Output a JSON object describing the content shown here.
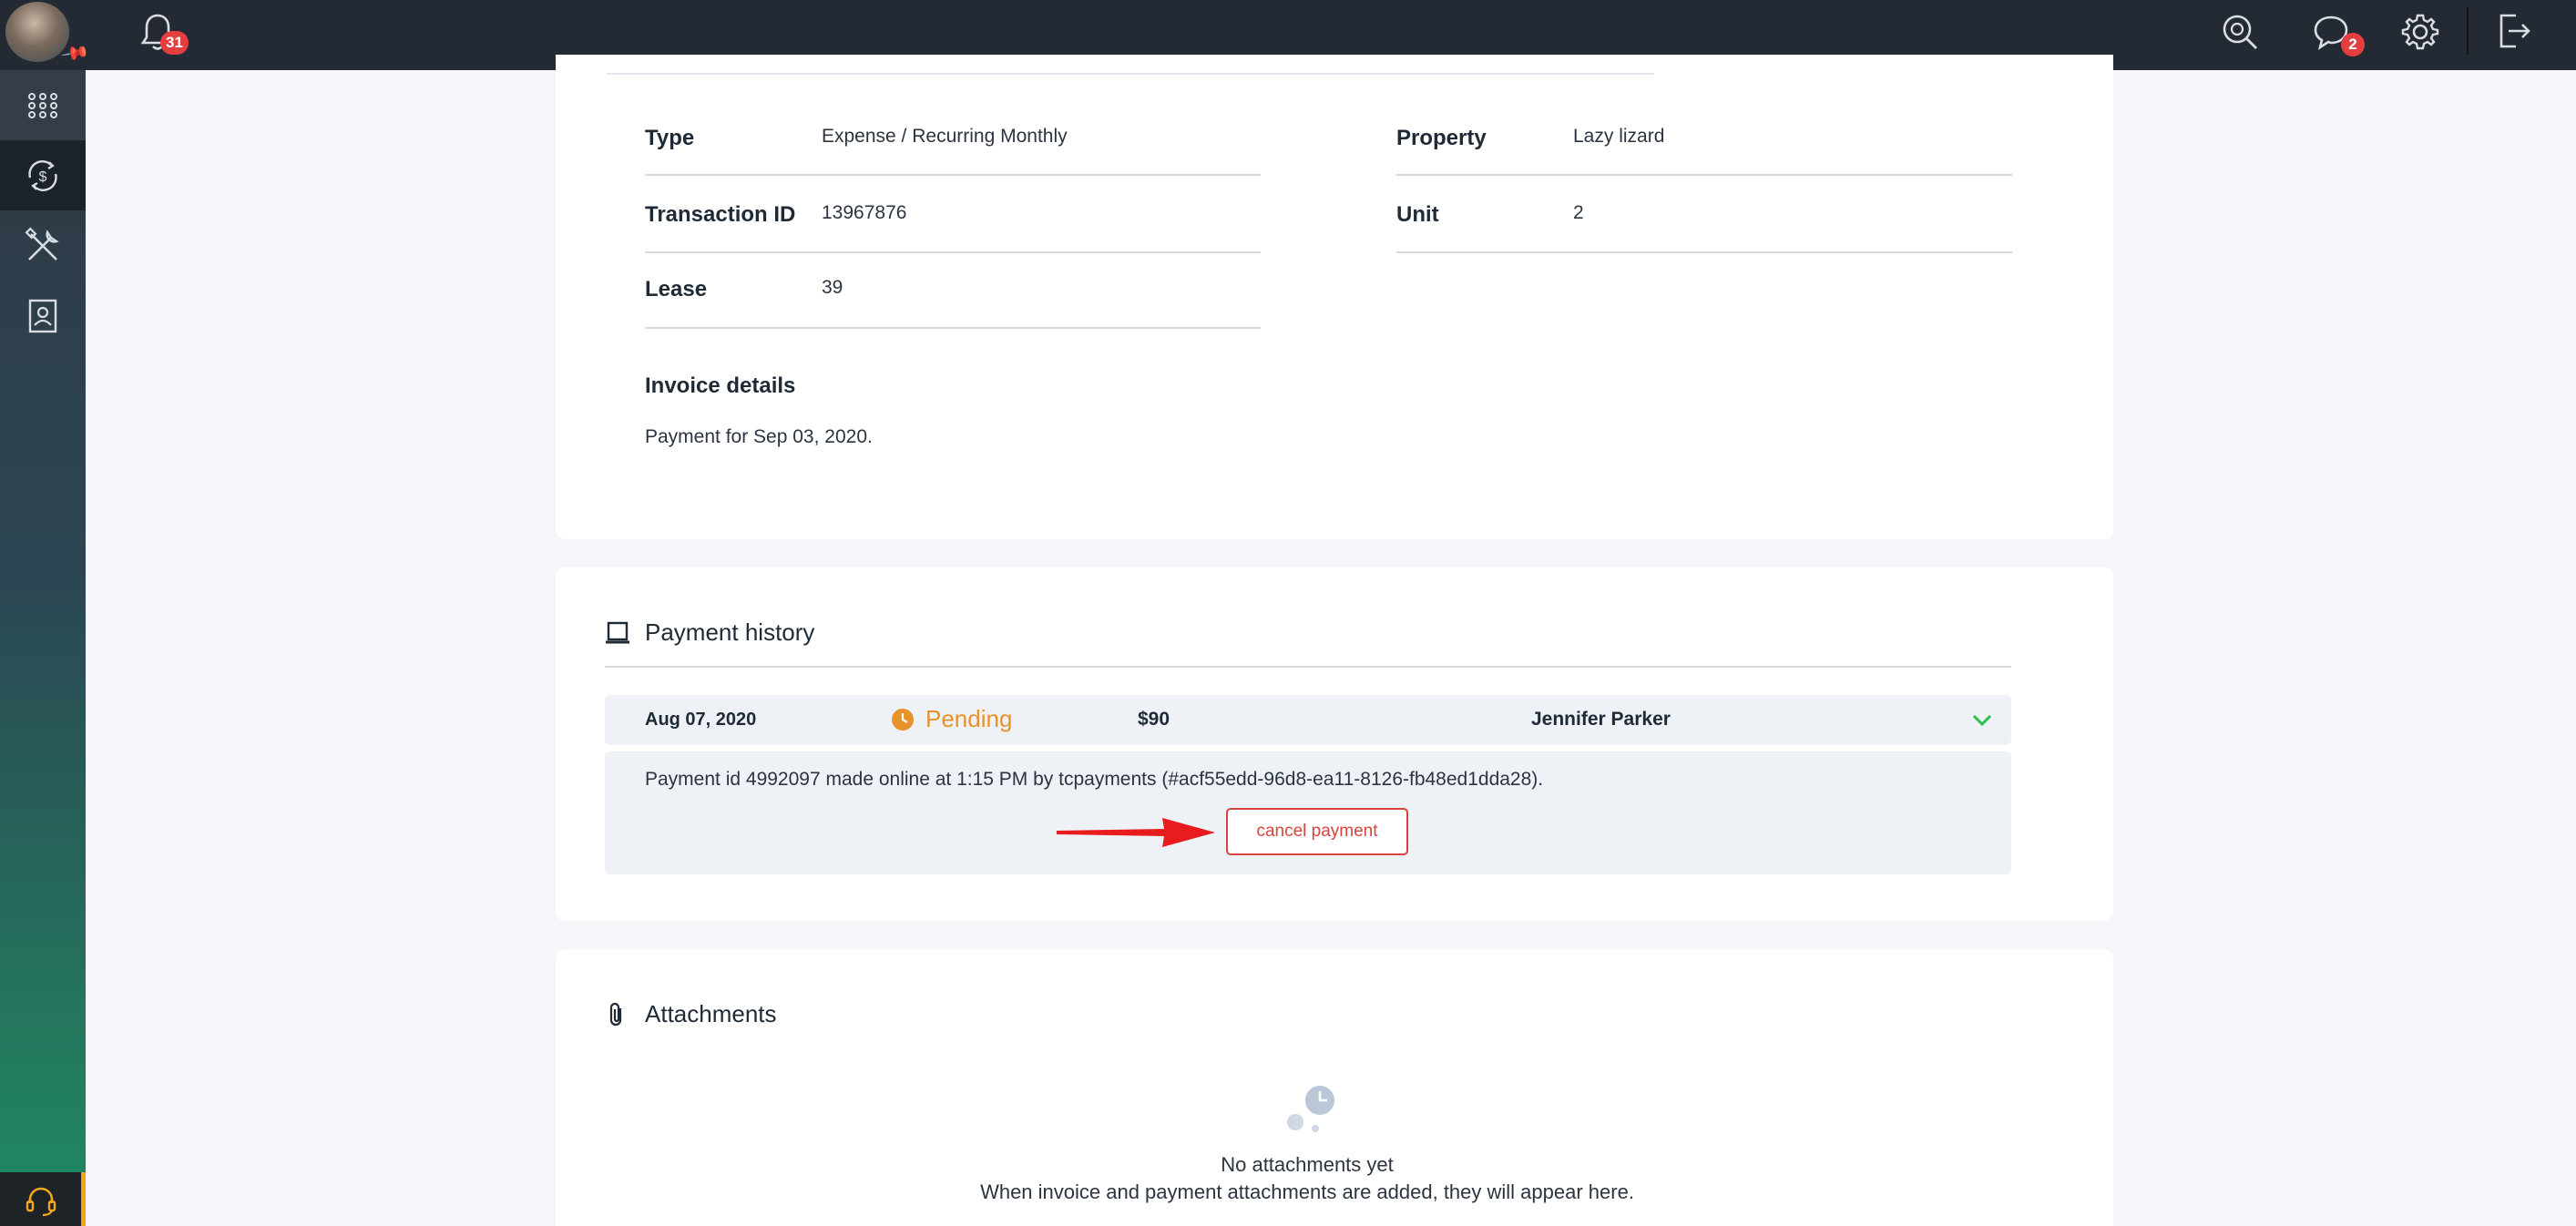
{
  "header": {
    "notifications_count": "31",
    "messages_count": "2"
  },
  "transaction": {
    "type_label": "Type",
    "type_value": "Expense / Recurring Monthly",
    "transaction_id_label": "Transaction ID",
    "transaction_id_value": "13967876",
    "lease_label": "Lease",
    "lease_value": "39",
    "property_label": "Property",
    "property_value": "Lazy lizard",
    "unit_label": "Unit",
    "unit_value": "2",
    "invoice_details_title": "Invoice details",
    "invoice_details_text": "Payment for Sep 03, 2020."
  },
  "payment_history": {
    "title": "Payment history",
    "row": {
      "date": "Aug 07, 2020",
      "status": "Pending",
      "amount": "$90",
      "payer": "Jennifer Parker"
    },
    "detail_text": "Payment id 4992097 made online at 1:15 PM by tcpayments (#acf55edd-96d8-ea11-8126-fb48ed1dda28).",
    "cancel_label": "cancel payment"
  },
  "attachments": {
    "title": "Attachments",
    "empty_title": "No attachments yet",
    "empty_text": "When invoice and payment attachments are added, they will appear here."
  },
  "colors": {
    "topbar": "#232a33",
    "pending": "#e8922a",
    "cancel": "#d6453d",
    "badge": "#e53e3e",
    "arrow": "#e81c1c",
    "chevron": "#2ebd4e",
    "support_accent": "#f1a817"
  }
}
